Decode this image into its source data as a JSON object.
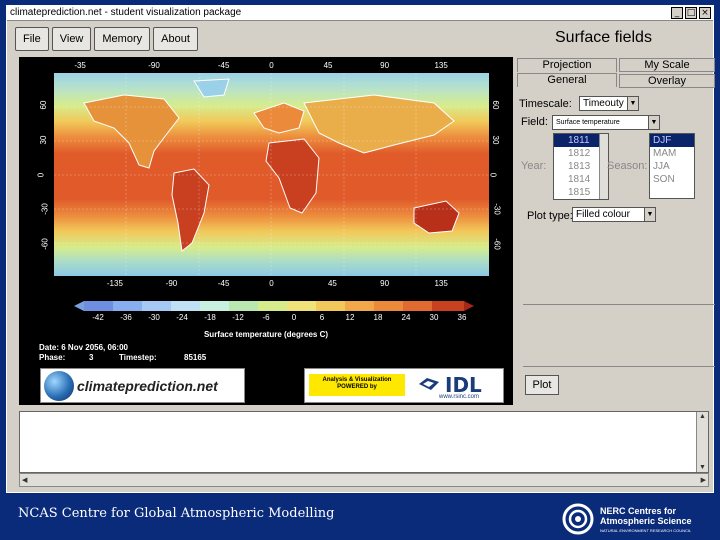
{
  "window": {
    "title": "climateprediction.net - student visualization package",
    "buttons": [
      "_",
      "□",
      "×"
    ]
  },
  "menu": [
    "File",
    "View",
    "Memory",
    "About"
  ],
  "panel": {
    "title": "Surface fields",
    "tabs": [
      {
        "label": "Projection"
      },
      {
        "label": "My Scale"
      },
      {
        "label": "General"
      },
      {
        "label": "Overlay"
      }
    ],
    "timescale": {
      "label": "Timescale:",
      "value": "Timeouty"
    },
    "field": {
      "label": "Field:",
      "value": "Surface temperature"
    },
    "year": {
      "label": "Year:",
      "items": [
        "1811",
        "1812",
        "1813",
        "1814",
        "1815"
      ],
      "selected": 0
    },
    "season": {
      "label": "Season:",
      "items": [
        "DJF",
        "MAM",
        "JJA",
        "SON"
      ],
      "selected": 0
    },
    "plottype": {
      "label": "Plot type:",
      "value": "Filled colour"
    },
    "plot_button": "Plot"
  },
  "figure": {
    "top_lon_labels": [
      "-35",
      "-90",
      "-45",
      "0",
      "45",
      "90",
      "135"
    ],
    "bottom_lon_labels": [
      "-135",
      "-90",
      "-45",
      "0",
      "45",
      "90",
      "135"
    ],
    "lat_labels": [
      "60",
      "30",
      "0",
      "-30",
      "-60"
    ],
    "colorbar_ticks": [
      "-42",
      "-36",
      "-30",
      "-24",
      "-18",
      "-12",
      "-6",
      "0",
      "6",
      "12",
      "18",
      "24",
      "30",
      "36"
    ],
    "colorbar_title": "Surface temperature (degrees C)",
    "date_label": "Date:",
    "date_value": "6 Nov 2056, 06:00",
    "phase_label": "Phase:",
    "phase_value": "3",
    "timestep_label": "Timestep:",
    "timestep_value": "85165",
    "cp_logo_text": "climateprediction.net",
    "idl_box_text": "Analysis & Visualization POWERED by",
    "idl_text": "IDL",
    "idl_url": "www.rsinc.com"
  },
  "footer": {
    "left_text": "NCAS Centre for Global Atmospheric Modelling",
    "nerc_line1": "NERC Centres for",
    "nerc_line2": "Atmospheric Science",
    "nerc_sub": "NATURAL ENVIRONMENT RESEARCH COUNCIL"
  },
  "colors": {
    "background": "#0a2a7a",
    "window": "#d4d0c8",
    "list_selection": "#0a246a",
    "idl_highlight": "#ffe800"
  }
}
